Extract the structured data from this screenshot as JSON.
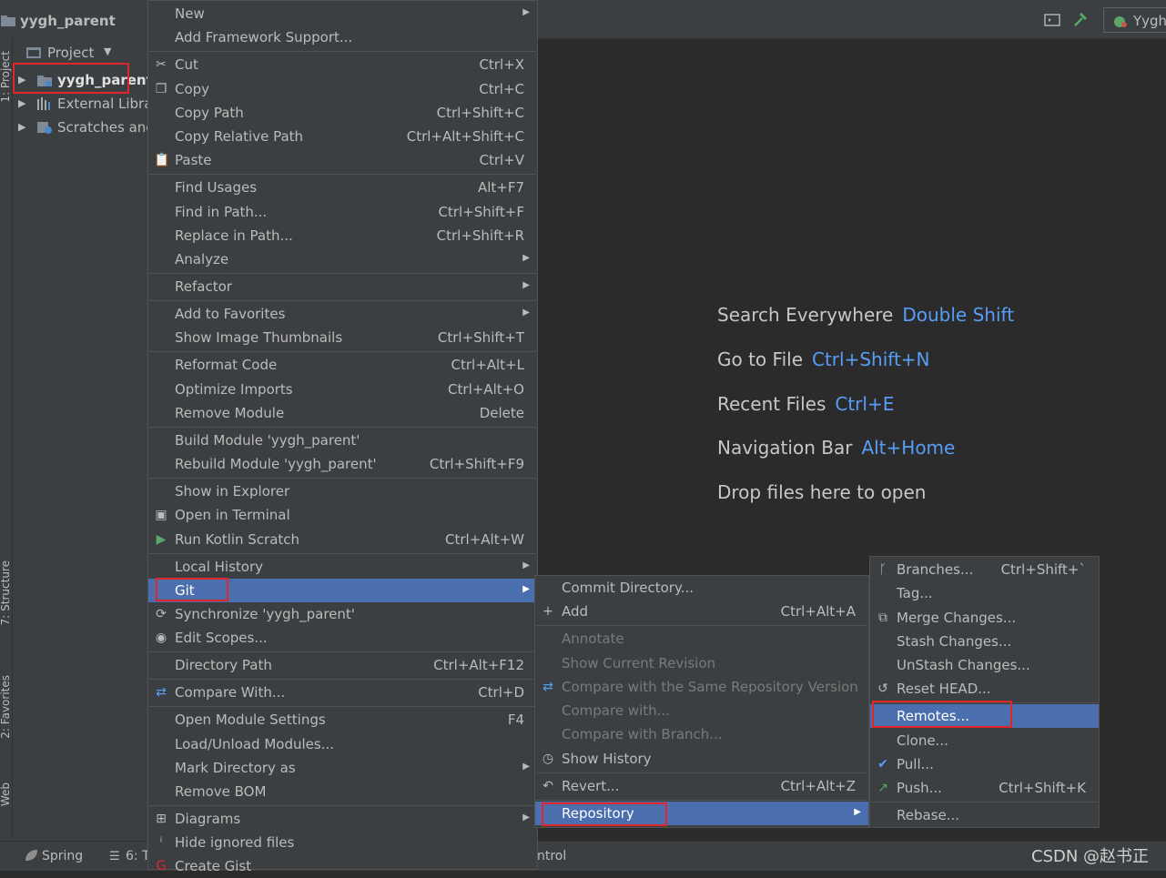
{
  "app": {
    "project_name": "yygh_parent",
    "run_config": "Yygh"
  },
  "sidebar": {
    "tabs": [
      "1: Project",
      "7: Structure",
      "2: Favorites",
      "Web"
    ],
    "header": "Project",
    "tree": [
      {
        "label": "yygh_parent"
      },
      {
        "label": "External Libra"
      },
      {
        "label": "Scratches anc"
      }
    ]
  },
  "editor": {
    "hints": [
      {
        "text": "Search Everywhere",
        "key": "Double Shift"
      },
      {
        "text": "Go to File",
        "key": "Ctrl+Shift+N"
      },
      {
        "text": "Recent Files",
        "key": "Ctrl+E"
      },
      {
        "text": "Navigation Bar",
        "key": "Alt+Home"
      },
      {
        "text": "Drop files here to open",
        "key": ""
      }
    ]
  },
  "statusbar": {
    "spring": "Spring",
    "tab6": "6: T",
    "ntrol": "ntrol",
    "watermark": "CSDN @赵书正"
  },
  "context_menu": [
    {
      "label": "New",
      "shortcut": "",
      "submenu": true
    },
    {
      "label": "Add Framework Support...",
      "shortcut": ""
    },
    {
      "label": "Cut",
      "shortcut": "Ctrl+X",
      "icon": "scissors-icon"
    },
    {
      "label": "Copy",
      "shortcut": "Ctrl+C",
      "icon": "copy-icon"
    },
    {
      "label": "Copy Path",
      "shortcut": "Ctrl+Shift+C"
    },
    {
      "label": "Copy Relative Path",
      "shortcut": "Ctrl+Alt+Shift+C"
    },
    {
      "label": "Paste",
      "shortcut": "Ctrl+V",
      "icon": "paste-icon"
    },
    {
      "label": "Find Usages",
      "shortcut": "Alt+F7"
    },
    {
      "label": "Find in Path...",
      "shortcut": "Ctrl+Shift+F"
    },
    {
      "label": "Replace in Path...",
      "shortcut": "Ctrl+Shift+R"
    },
    {
      "label": "Analyze",
      "shortcut": "",
      "submenu": true
    },
    {
      "label": "Refactor",
      "shortcut": "",
      "submenu": true
    },
    {
      "label": "Add to Favorites",
      "shortcut": "",
      "submenu": true
    },
    {
      "label": "Show Image Thumbnails",
      "shortcut": "Ctrl+Shift+T"
    },
    {
      "label": "Reformat Code",
      "shortcut": "Ctrl+Alt+L"
    },
    {
      "label": "Optimize Imports",
      "shortcut": "Ctrl+Alt+O"
    },
    {
      "label": "Remove Module",
      "shortcut": "Delete"
    },
    {
      "label": "Build Module 'yygh_parent'",
      "shortcut": ""
    },
    {
      "label": "Rebuild Module 'yygh_parent'",
      "shortcut": "Ctrl+Shift+F9"
    },
    {
      "label": "Show in Explorer",
      "shortcut": ""
    },
    {
      "label": "Open in Terminal",
      "shortcut": "",
      "icon": "terminal-icon"
    },
    {
      "label": "Run Kotlin Scratch",
      "shortcut": "Ctrl+Alt+W",
      "icon": "run-icon"
    },
    {
      "label": "Local History",
      "shortcut": "",
      "submenu": true
    },
    {
      "label": "Git",
      "shortcut": "",
      "submenu": true,
      "selected": true
    },
    {
      "label": "Synchronize 'yygh_parent'",
      "shortcut": "",
      "icon": "sync-icon"
    },
    {
      "label": "Edit Scopes...",
      "shortcut": "",
      "icon": "scope-icon"
    },
    {
      "label": "Directory Path",
      "shortcut": "Ctrl+Alt+F12"
    },
    {
      "label": "Compare With...",
      "shortcut": "Ctrl+D",
      "icon": "compare-icon"
    },
    {
      "label": "Open Module Settings",
      "shortcut": "F4"
    },
    {
      "label": "Load/Unload Modules...",
      "shortcut": ""
    },
    {
      "label": "Mark Directory as",
      "shortcut": "",
      "submenu": true
    },
    {
      "label": "Remove BOM",
      "shortcut": ""
    },
    {
      "label": "Diagrams",
      "shortcut": "",
      "submenu": true,
      "icon": "diagram-icon"
    },
    {
      "label": "Hide ignored files",
      "shortcut": "",
      "icon": "ignore-icon"
    },
    {
      "label": "Create Gist",
      "shortcut": "",
      "icon": "gist-icon"
    }
  ],
  "git_menu": [
    {
      "label": "Commit Directory...",
      "shortcut": ""
    },
    {
      "label": "Add",
      "shortcut": "Ctrl+Alt+A",
      "icon": "plus-icon"
    },
    {
      "label": "Annotate",
      "shortcut": "",
      "disabled": true
    },
    {
      "label": "Show Current Revision",
      "shortcut": "",
      "disabled": true
    },
    {
      "label": "Compare with the Same Repository Version",
      "shortcut": "",
      "disabled": true,
      "icon": "compare-icon"
    },
    {
      "label": "Compare with...",
      "shortcut": "",
      "disabled": true
    },
    {
      "label": "Compare with Branch...",
      "shortcut": "",
      "disabled": true
    },
    {
      "label": "Show History",
      "shortcut": "",
      "icon": "history-icon"
    },
    {
      "label": "Revert...",
      "shortcut": "Ctrl+Alt+Z",
      "icon": "revert-icon"
    },
    {
      "label": "Repository",
      "shortcut": "",
      "submenu": true,
      "selected": true
    }
  ],
  "repo_menu": [
    {
      "label": "Branches...",
      "shortcut": "Ctrl+Shift+`",
      "icon": "branch-icon"
    },
    {
      "label": "Tag...",
      "shortcut": ""
    },
    {
      "label": "Merge Changes...",
      "shortcut": "",
      "icon": "merge-icon"
    },
    {
      "label": "Stash Changes...",
      "shortcut": ""
    },
    {
      "label": "UnStash Changes...",
      "shortcut": ""
    },
    {
      "label": "Reset HEAD...",
      "shortcut": "",
      "icon": "reset-icon"
    },
    {
      "label": "Remotes...",
      "shortcut": "",
      "selected": true
    },
    {
      "label": "Clone...",
      "shortcut": ""
    },
    {
      "label": "Pull...",
      "shortcut": "",
      "icon": "pull-icon"
    },
    {
      "label": "Push...",
      "shortcut": "Ctrl+Shift+K",
      "icon": "push-icon"
    },
    {
      "label": "Rebase...",
      "shortcut": ""
    }
  ],
  "colors": {
    "selection": "#4b6eaf",
    "highlight_box": "#e0262a",
    "shortcut_blue": "#589df6"
  }
}
